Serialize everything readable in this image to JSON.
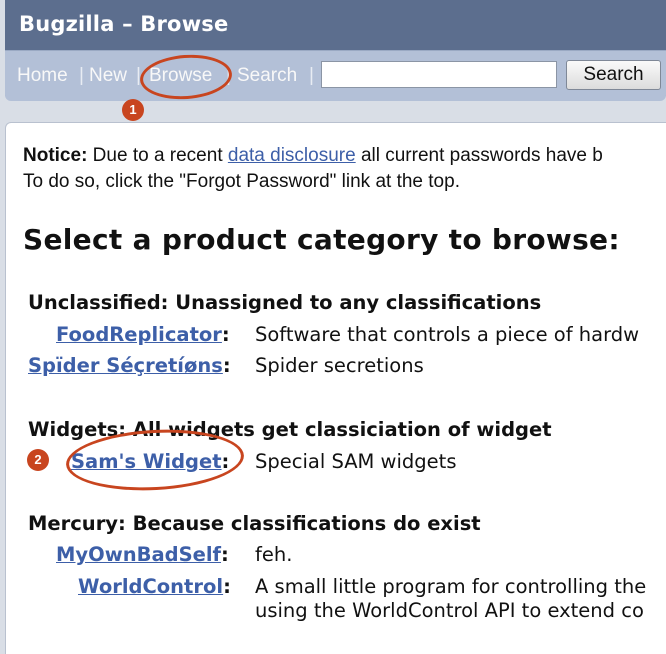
{
  "header": {
    "title": "Bugzilla – Browse"
  },
  "nav": {
    "items": [
      "Home",
      "New",
      "Browse",
      "Search"
    ],
    "separator": "|",
    "search_button": "Search",
    "search_value": ""
  },
  "callouts": {
    "one": "1",
    "two": "2"
  },
  "notice": {
    "label": "Notice:",
    "text_before": " Due to a recent ",
    "link": "data disclosure",
    "text_after": " all current passwords have b",
    "line2": "To do so, click the \"Forgot Password\" link at the top."
  },
  "heading": "Select a product category to browse:",
  "classifications": [
    {
      "title": "Unclassified: Unassigned to any classifications",
      "products": [
        {
          "name": "FoodReplicator",
          "desc": "Software that controls a piece of hardw"
        },
        {
          "name": "Spïder Séçretíøns",
          "desc": "Spider secretions"
        }
      ]
    },
    {
      "title": "Widgets: All widgets get classiciation of widget",
      "products": [
        {
          "name": "Sam's Widget",
          "desc": "Special SAM widgets"
        }
      ]
    },
    {
      "title": "Mercury: Because classifications do exist",
      "products": [
        {
          "name": "MyOwnBadSelf",
          "desc": "feh."
        },
        {
          "name": "WorldControl",
          "desc": "A small little program for controlling the",
          "desc2": "using the WorldControl API to extend co"
        }
      ]
    }
  ],
  "colors": {
    "header_bg": "#5c6e8e",
    "nav_bg": "#b3c0d7",
    "link": "#3d5fa8",
    "callout": "#c8451f"
  }
}
